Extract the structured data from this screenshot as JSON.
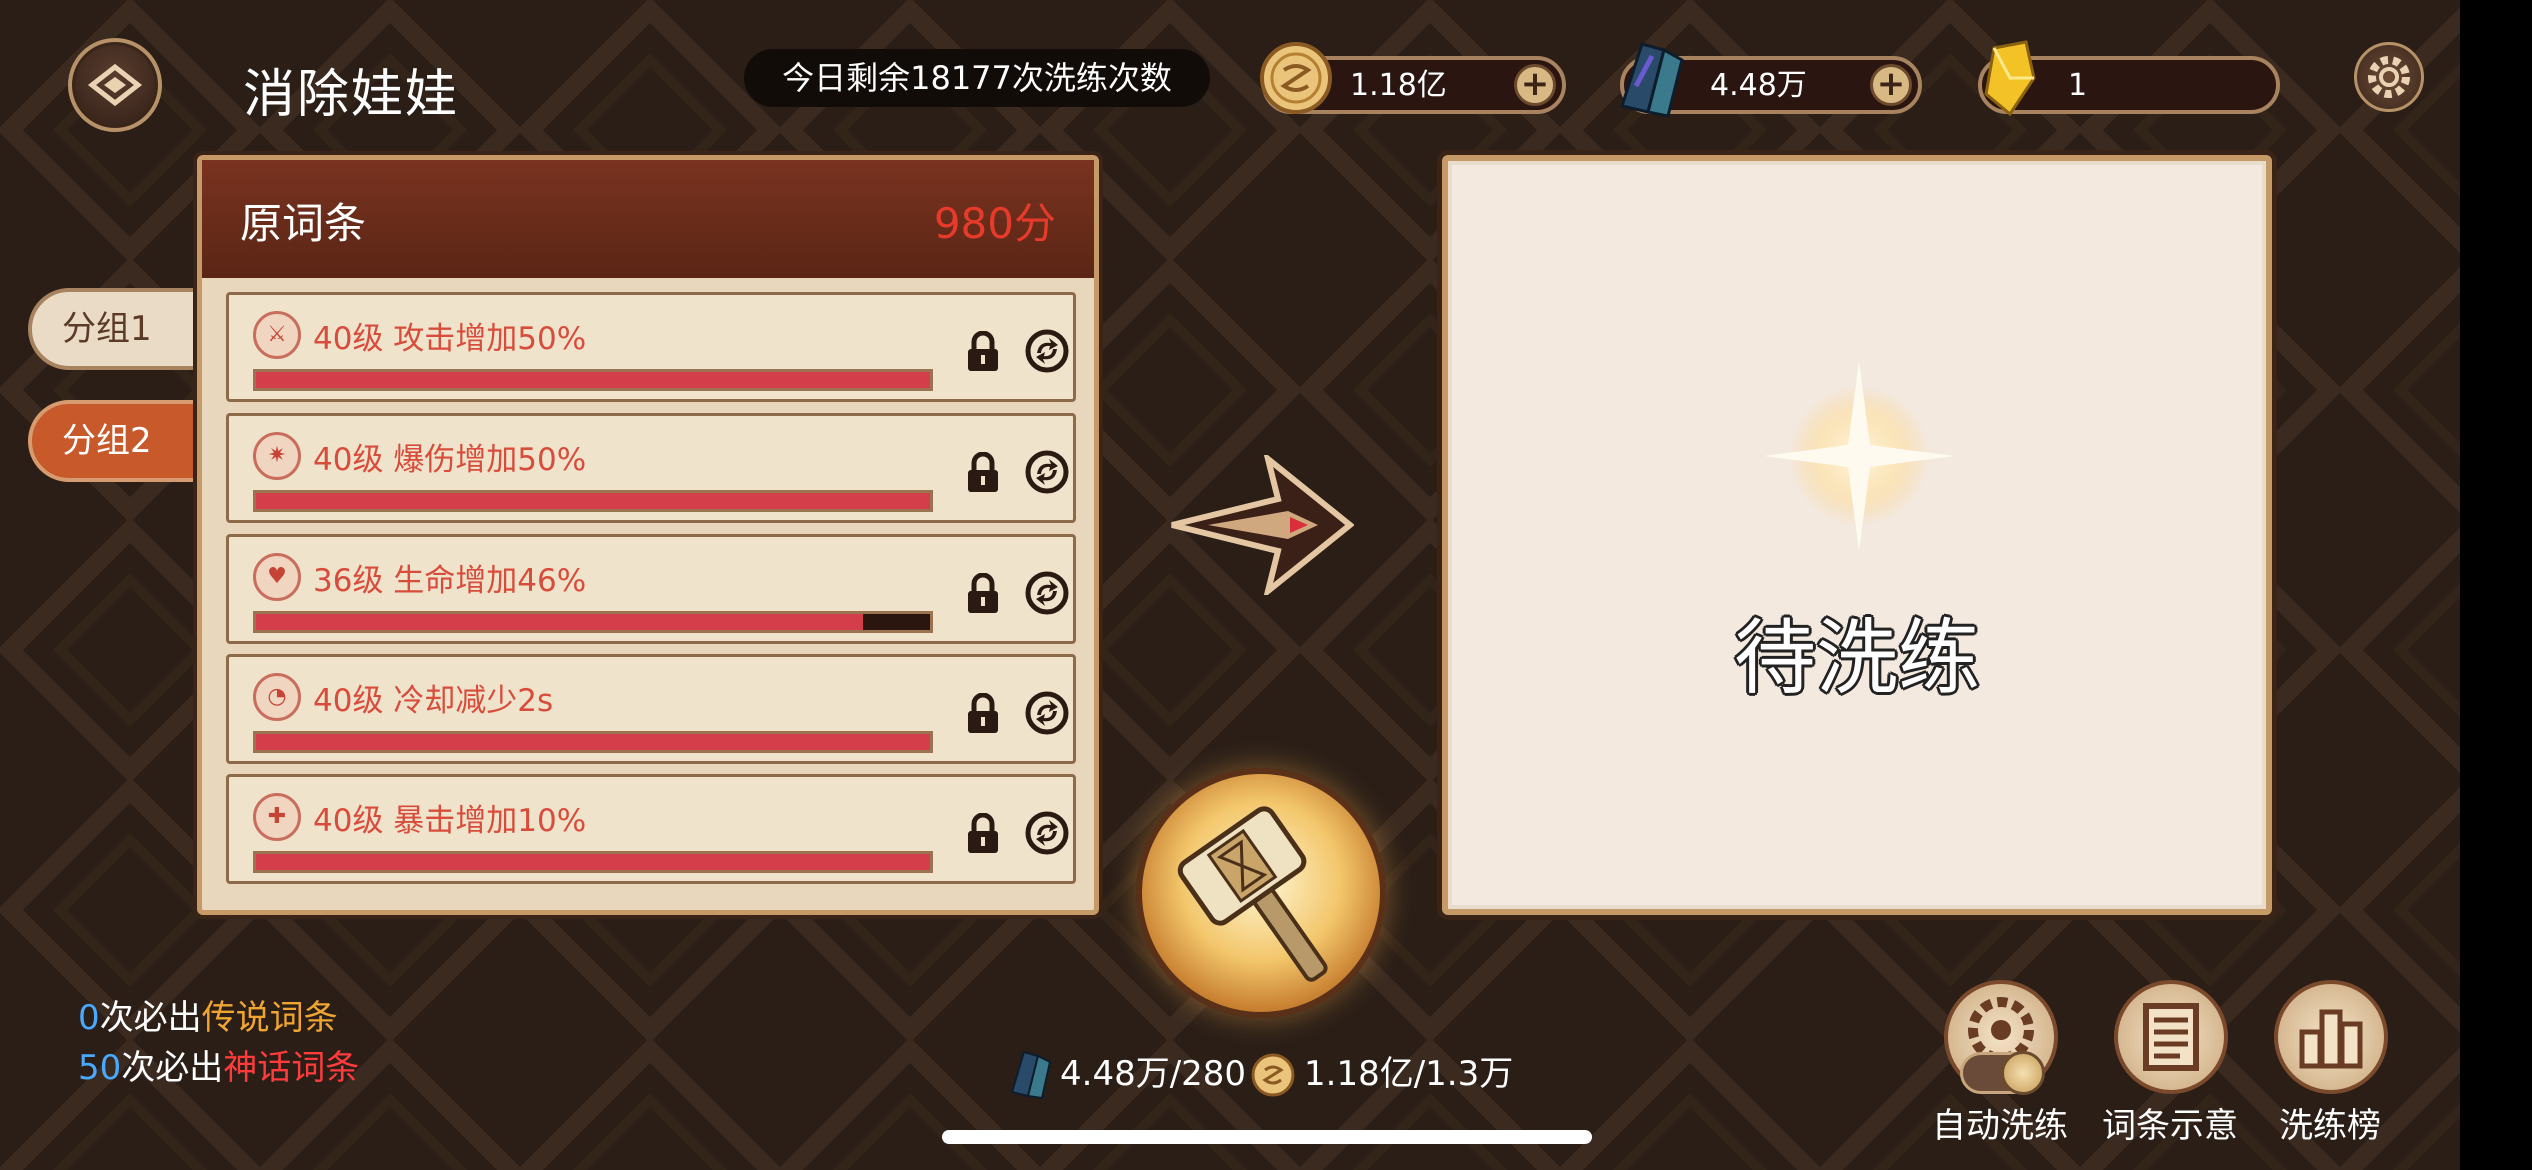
{
  "header": {
    "title": "消除娃娃",
    "refine_count_text": "今日剩余18177次洗练次数",
    "gold": "1.18亿",
    "crystal": "4.48万",
    "gem": "1",
    "plus_glyph": "+"
  },
  "groups": [
    {
      "label": "分组1",
      "selected": false
    },
    {
      "label": "分组2",
      "selected": true
    }
  ],
  "left_panel": {
    "title": "原词条",
    "score": "980分",
    "entries": [
      {
        "text": "40级 攻击增加50%",
        "icon": "sword-icon",
        "glyph": "⚔",
        "progress": 1.0
      },
      {
        "text": "40级 爆伤增加50%",
        "icon": "burst-icon",
        "glyph": "✷",
        "progress": 1.0
      },
      {
        "text": "36级 生命增加46%",
        "icon": "heart-icon",
        "glyph": "♥",
        "progress": 0.9
      },
      {
        "text": "40级 冷却减少2s",
        "icon": "cooldown-icon",
        "glyph": "◔",
        "progress": 1.0
      },
      {
        "text": "40级 暴击增加10%",
        "icon": "crit-icon",
        "glyph": "✚",
        "progress": 1.0
      }
    ]
  },
  "right_panel": {
    "status_text": "待洗练"
  },
  "pity": {
    "legend_count": "0",
    "legend_mid": "次必出",
    "legend_name": "传说词条",
    "myth_count": "50",
    "myth_mid": "次必出",
    "myth_name": "神话词条"
  },
  "cost": {
    "crystal": "4.48万/280",
    "gold": "1.18亿/1.3万"
  },
  "bottom_buttons": {
    "auto": "自动洗练",
    "preview": "词条示意",
    "ranking": "洗练榜"
  },
  "colors": {
    "accent_red": "#d84c3b",
    "legend_orange": "#f0a531",
    "myth_red": "#ff3b3b",
    "count_blue": "#4aa8ff"
  }
}
